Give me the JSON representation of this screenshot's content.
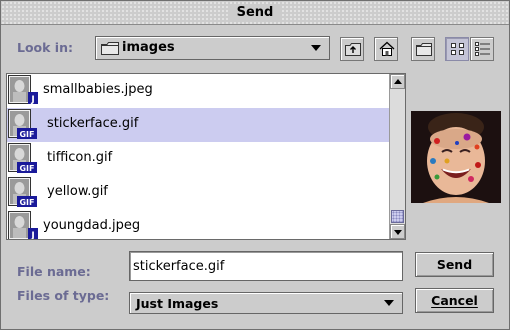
{
  "dialog": {
    "title": "Send"
  },
  "look_in": {
    "label": "Look in:",
    "value": "images",
    "folder_icon": "folder-icon"
  },
  "toolbar": {
    "buttons": [
      {
        "name": "up-one-level",
        "icon": "up-folder-icon"
      },
      {
        "name": "home",
        "icon": "home-icon"
      },
      {
        "name": "new-folder",
        "icon": "new-folder-icon"
      },
      {
        "name": "list-view",
        "icon": "list-view-icon"
      },
      {
        "name": "details-view",
        "icon": "details-view-icon"
      }
    ]
  },
  "files": [
    {
      "name": "smallbabies.jpeg",
      "badge": "J",
      "selected": false
    },
    {
      "name": "stickerface.gif",
      "badge": "GIF",
      "selected": true
    },
    {
      "name": "tifficon.gif",
      "badge": "GIF",
      "selected": false
    },
    {
      "name": "yellow.gif",
      "badge": "GIF",
      "selected": false
    },
    {
      "name": "youngdad.jpeg",
      "badge": "J",
      "selected": false
    }
  ],
  "file_name": {
    "label": "File name:",
    "value": "stickerface.gif"
  },
  "files_of_type": {
    "label": "Files of type:",
    "value": "Just Images"
  },
  "buttons": {
    "send": "Send",
    "cancel": "Cancel"
  },
  "colors": {
    "label_text": "#6b6b93",
    "selection": "#ccccf0",
    "background": "#cccccc",
    "badge": "#1a1a9a"
  }
}
